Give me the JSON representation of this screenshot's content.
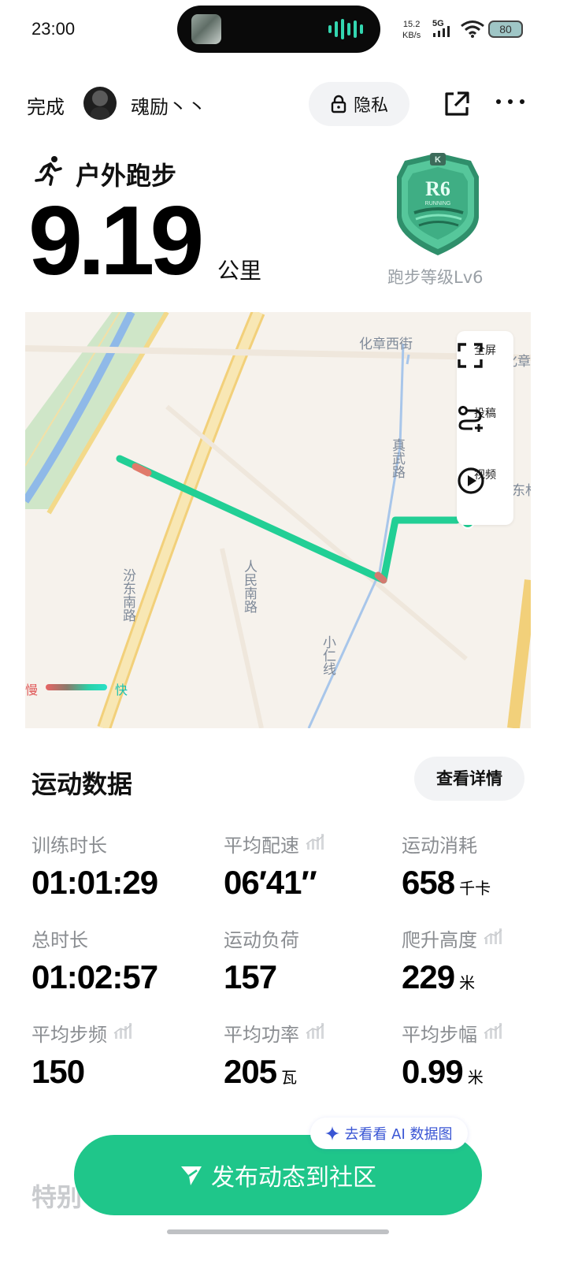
{
  "status_bar": {
    "time": "23:00",
    "net_speed_value": "15.2",
    "net_speed_unit": "KB/s",
    "network": "5G",
    "battery": "80"
  },
  "nav": {
    "done_label": "完成",
    "username": "魂励丶丶",
    "privacy_label": "隐私"
  },
  "workout": {
    "type": "户外跑步",
    "distance": "9.19",
    "distance_unit": "公里",
    "badge_level_label": "跑步等级Lv6",
    "badge_code": "R6",
    "badge_text": "RUNNING",
    "badge_k": "K"
  },
  "map": {
    "labels": {
      "street_1": "化章西街",
      "street_2": "真武路",
      "street_3": "人民南路",
      "street_4": "汾东南路",
      "street_5": "小仁线",
      "street_6": "化章",
      "street_7": "东杉"
    },
    "tools": [
      {
        "label": "全屏",
        "icon": "fullscreen-icon"
      },
      {
        "label": "投稿",
        "icon": "route-submit-icon"
      },
      {
        "label": "视频",
        "icon": "play-icon"
      }
    ],
    "legend": {
      "slow": "慢",
      "fast": "快"
    }
  },
  "stats": {
    "section_title": "运动数据",
    "details_label": "查看详情",
    "items": [
      {
        "label": "训练时长",
        "value": "01:01:29",
        "unit": "",
        "has_chart": false
      },
      {
        "label": "平均配速",
        "value": "06′41″",
        "unit": "",
        "has_chart": true
      },
      {
        "label": "运动消耗",
        "value": "658",
        "unit": "千卡",
        "has_chart": false
      },
      {
        "label": "总时长",
        "value": "01:02:57",
        "unit": "",
        "has_chart": false
      },
      {
        "label": "运动负荷",
        "value": "157",
        "unit": "",
        "has_chart": false
      },
      {
        "label": "爬升高度",
        "value": "229",
        "unit": "米",
        "has_chart": true
      },
      {
        "label": "平均步频",
        "value": "150",
        "unit": "",
        "has_chart": true
      },
      {
        "label": "平均功率",
        "value": "205",
        "unit": "瓦",
        "has_chart": true
      },
      {
        "label": "平均步幅",
        "value": "0.99",
        "unit": "米",
        "has_chart": true
      }
    ]
  },
  "bottom": {
    "ai_label": "去看看 AI 数据图",
    "publish_label": "发布动态到社区",
    "special_title": "特别"
  },
  "colors": {
    "accent": "#1fc68a",
    "route": "#22cf95",
    "ai": "#3a56d4"
  }
}
